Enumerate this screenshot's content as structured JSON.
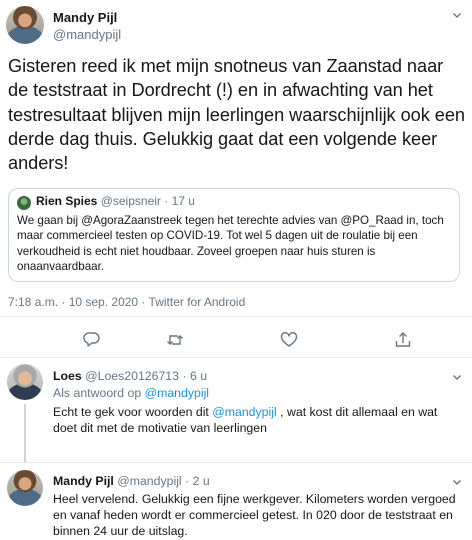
{
  "main_tweet": {
    "author_name": "Mandy Pijl",
    "author_handle": "@mandypijl",
    "text": "Gisteren reed ik met mijn snotneus van Zaanstad naar de teststraat in Dordrecht (!) en in afwachting van het testresultaat blijven mijn leerlingen waarschijnlijk ook een derde dag thuis. Gelukkig gaat dat een volgende keer anders!",
    "quote": {
      "author_name": "Rien Spies",
      "author_handle": "@seipsneir",
      "separator": "·",
      "time": "17 u",
      "text": "We gaan bij @AgoraZaanstreek tegen het terechte advies van @PO_Raad in, toch maar commercieel testen op COVID-19. Tot wel 5 dagen uit de roulatie bij een verkoudheid is echt niet houdbaar. Zoveel groepen naar huis sturen is onaanvaardbaar."
    },
    "meta": "7:18 a.m. · 10 sep. 2020 · Twitter for Android",
    "actions": [
      "reply-icon",
      "retweet-icon",
      "like-icon",
      "share-icon"
    ]
  },
  "replies": [
    {
      "author_name": "Loes",
      "author_handle": "@Loes20126713",
      "separator": "·",
      "time": "6 u",
      "reply_to_prefix": "Als antwoord op",
      "reply_to_handle": "@mandypijl",
      "text_before": "Echt te gek voor woorden dit",
      "mention": "@mandypijl",
      "text_after": ", wat kost dit allemaal en wat doet dit met de motivatie van leerlingen"
    },
    {
      "author_name": "Mandy Pijl",
      "author_handle": "@mandypijl",
      "separator": "·",
      "time": "2 u",
      "text": "Heel vervelend. Gelukkig een fijne werkgever. Kilometers worden vergoed en vanaf heden wordt er commercieel getest. In 020 door de teststraat en binnen 24 uur de uitslag."
    }
  ],
  "colors": {
    "link": "#1b95e0",
    "secondary_text": "#657786",
    "border": "#ccd6dd",
    "text": "#14171a"
  }
}
